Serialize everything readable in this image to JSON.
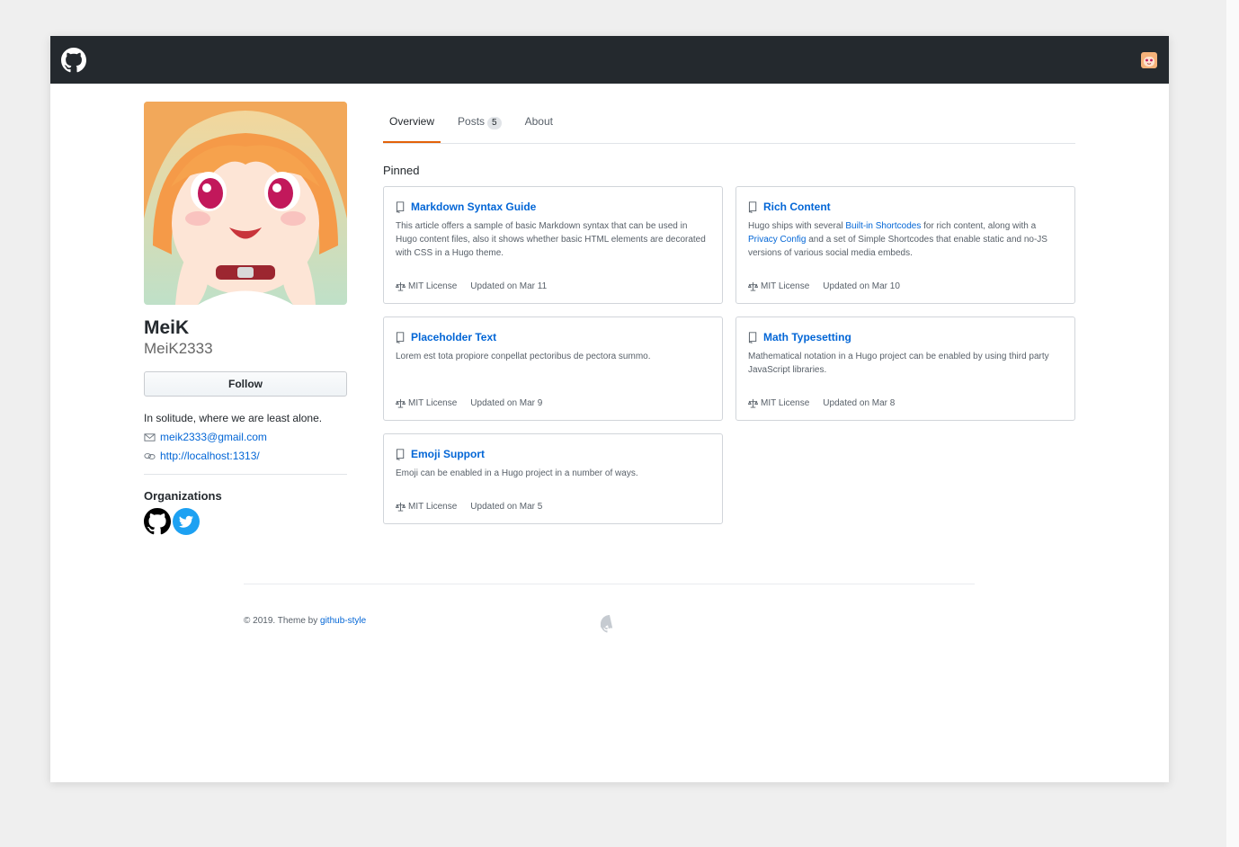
{
  "header": {
    "logo_icon": "github-mark-icon",
    "avatar_icon": "user-avatar-icon"
  },
  "profile": {
    "name": "MeiK",
    "login": "MeiK2333",
    "follow_label": "Follow",
    "bio": "In solitude, where we are least alone.",
    "email": "meik2333@gmail.com",
    "website": "http://localhost:1313/",
    "organizations_title": "Organizations",
    "organizations": [
      {
        "icon": "github-mark-icon"
      },
      {
        "icon": "twitter-bird-icon"
      }
    ]
  },
  "tabs": [
    {
      "label": "Overview",
      "active": true
    },
    {
      "label": "Posts",
      "count": "5"
    },
    {
      "label": "About"
    }
  ],
  "pinned": {
    "title": "Pinned",
    "cards": [
      {
        "title": "Markdown Syntax Guide",
        "desc": "This article offers a sample of basic Markdown syntax that can be used in Hugo content files, also it shows whether basic HTML elements are decorated with CSS in a Hugo theme.",
        "license": "MIT License",
        "updated": "Updated on Mar 11"
      },
      {
        "title": "Rich Content",
        "desc_parts": [
          "Hugo ships with several ",
          "Built-in Shortcodes",
          " for rich content, along with a ",
          "Privacy Config",
          " and a set of Simple Shortcodes that enable static and no-JS versions of various social media embeds."
        ],
        "license": "MIT License",
        "updated": "Updated on Mar 10"
      },
      {
        "title": "Placeholder Text",
        "desc": "Lorem est tota propiore conpellat pectoribus de pectora summo.",
        "license": "MIT License",
        "updated": "Updated on Mar 9"
      },
      {
        "title": "Math Typesetting",
        "desc": "Mathematical notation in a Hugo project can be enabled by using third party JavaScript libraries.",
        "license": "MIT License",
        "updated": "Updated on Mar 8"
      },
      {
        "title": "Emoji Support",
        "desc": "Emoji can be enabled in a Hugo project in a number of ways.",
        "license": "MIT License",
        "updated": "Updated on Mar 5"
      }
    ]
  },
  "footer": {
    "copyright": "© 2019. Theme by ",
    "theme_link": "github-style"
  },
  "colors": {
    "header_bg": "#24292e",
    "link": "#0366d6",
    "tab_underline": "#e36209",
    "twitter": "#1da1f2"
  }
}
